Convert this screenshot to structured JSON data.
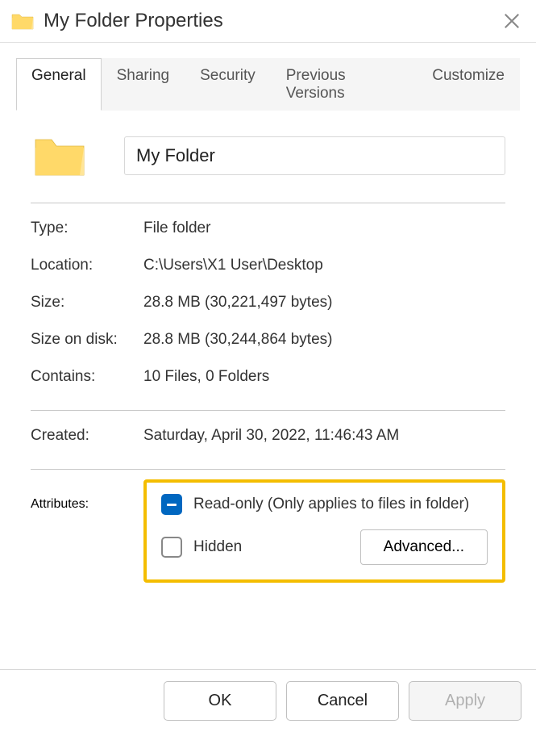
{
  "titlebar": {
    "title": "My Folder Properties"
  },
  "tabs": {
    "general": "General",
    "sharing": "Sharing",
    "security": "Security",
    "previous_versions": "Previous Versions",
    "customize": "Customize"
  },
  "folder": {
    "name": "My Folder"
  },
  "labels": {
    "type": "Type:",
    "location": "Location:",
    "size": "Size:",
    "size_on_disk": "Size on disk:",
    "contains": "Contains:",
    "created": "Created:",
    "attributes": "Attributes:"
  },
  "values": {
    "type": "File folder",
    "location": "C:\\Users\\X1 User\\Desktop",
    "size": "28.8 MB (30,221,497 bytes)",
    "size_on_disk": "28.8 MB (30,244,864 bytes)",
    "contains": "10 Files, 0 Folders",
    "created": "Saturday, April 30, 2022, 11:46:43 AM"
  },
  "attributes": {
    "readonly_label": "Read-only (Only applies to files in folder)",
    "hidden_label": "Hidden",
    "advanced_button": "Advanced..."
  },
  "buttons": {
    "ok": "OK",
    "cancel": "Cancel",
    "apply": "Apply"
  }
}
